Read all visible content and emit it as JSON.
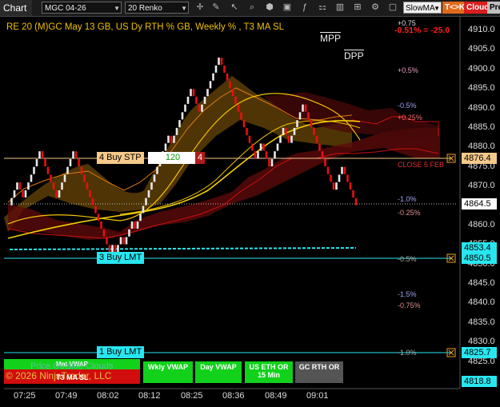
{
  "toolbar": {
    "chart_label": "Chart",
    "instrument": "MGC 04-26",
    "bar_type": "20 Renko",
    "indicator_select": "SlowMA",
    "tlk": "T<>K",
    "cloud": "Cloud",
    "premium": "Prem"
  },
  "chart": {
    "title": "RE 20  (M)GC May 13 GB, US Dy RTH % GB, Weekly % , T3 MA SL",
    "mpp": "MPP",
    "dpp": "DPP",
    "y_ticks": [
      "4910.0",
      "4905.0",
      "4900.0",
      "4895.0",
      "4890.0",
      "4885.0",
      "4880.0",
      "4875.0",
      "4870.0",
      "4865.0",
      "4860.0",
      "4855.0",
      "4850.0",
      "4845.0",
      "4840.0",
      "4835.0",
      "4830.0",
      "4825.0",
      "4820.0"
    ],
    "x_ticks": [
      "07:25",
      "07:49",
      "08:02",
      "08:12",
      "08:25",
      "08:36",
      "08:49",
      "09:01"
    ],
    "percent_labels": {
      "p075": "+0.75",
      "neg051": "-0.51% = -25.0",
      "pos05": "+0.5%",
      "neg05": "-0.5%",
      "pos025": "+0.25%",
      "close5feb": "CLOSE 5 FEB",
      "neg10a": "-1.0%",
      "neg025": "-0.25%",
      "neg05b": "-0.5%",
      "neg15": "-1.5%",
      "neg075": "-0.75%",
      "neg10b": "-1.0%"
    },
    "price_markers": {
      "stop": "4876.4",
      "last": "4864.5",
      "lmt3_upper": "4853.4",
      "lmt3": "4850.5",
      "lmt1": "4825.7",
      "bottom": "4818.8"
    },
    "orders": {
      "stop_label": "4 Buy STP",
      "stop_qty": "120",
      "stop_x": "4",
      "lmt3_label": "3 Buy LMT",
      "lmt1_label": "1 Buy LMT"
    },
    "buttons": {
      "mnt_vwap": "Mnt VWAP",
      "price_outside": "Price Outside Clouds",
      "copyright": "© 2026 NinjaTrader, LLC",
      "t3ma": "T3 MA SL",
      "wkly_vwap": "Wkly VWAP",
      "day_vwap": "Day VWAP",
      "us_eth": "US ETH OR 15 Min",
      "gc_rth": "GC RTH OR"
    },
    "colors": {
      "up_brick": "#e8e8e8",
      "down_brick": "#e81010",
      "cloud_bull": "#8a5a0a",
      "cloud_bear": "#5a0808",
      "slow_ma": "#f0d000",
      "stop_line": "#f5c98a",
      "limit_line": "#28e6f0",
      "button_green": "#11d11b"
    }
  },
  "chart_data": {
    "type": "line",
    "title": "RE 20  (M)GC May 13 GB, US Dy RTH % GB, Weekly % , T3 MA SL",
    "series": [
      {
        "name": "Renko",
        "values": [
          4865,
          4867,
          4869,
          4871,
          4869,
          4867,
          4869,
          4871,
          4873,
          4875,
          4877,
          4879,
          4877,
          4875,
          4873,
          4871,
          4869,
          4867,
          4869,
          4871,
          4873,
          4875,
          4877,
          4879,
          4877,
          4875,
          4873,
          4871,
          4869,
          4867,
          4865,
          4863,
          4861,
          4859,
          4857,
          4855,
          4853,
          4855,
          4853,
          4855,
          4857,
          4855,
          4857,
          4859,
          4861,
          4859,
          4861,
          4863,
          4865,
          4867,
          4869,
          4871,
          4873,
          4875,
          4877,
          4879,
          4881,
          4883,
          4881,
          4883,
          4885,
          4887,
          4889,
          4891,
          4893,
          4895,
          4893,
          4891,
          4889,
          4891,
          4893,
          4895,
          4897,
          4899,
          4901,
          4903,
          4901,
          4899,
          4897,
          4895,
          4893,
          4891,
          4889,
          4887,
          4885,
          4883,
          4881,
          4879,
          4877,
          4879,
          4881,
          4879,
          4877,
          4875,
          4877,
          4879,
          4881,
          4883,
          4885,
          4883,
          4881,
          4883,
          4885,
          4887,
          4889,
          4891,
          4889,
          4887,
          4885,
          4883,
          4881,
          4879,
          4877,
          4875,
          4873,
          4871,
          4869,
          4871,
          4873,
          4875,
          4873,
          4871,
          4869,
          4867,
          4865
        ]
      }
    ],
    "ylim": [
      4815,
      4912
    ],
    "y_ticks": [
      4910,
      4905,
      4900,
      4895,
      4890,
      4885,
      4880,
      4875,
      4870,
      4865,
      4860,
      4855,
      4850,
      4845,
      4840,
      4835,
      4830,
      4825,
      4820
    ],
    "x_ticks": [
      "07:25",
      "07:49",
      "08:02",
      "08:12",
      "08:25",
      "08:36",
      "08:49",
      "09:01"
    ],
    "horizontal_levels": {
      "stop": 4876.4,
      "last": 4864.5,
      "limit3": 4850.5,
      "limit1": 4825.7,
      "cyan_dash": 4853.4
    }
  }
}
